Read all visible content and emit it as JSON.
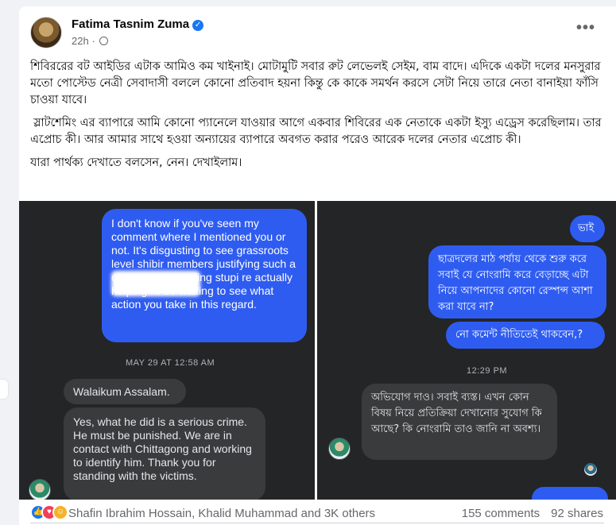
{
  "post": {
    "author": "Fatima Tasnim Zuma",
    "time": "22h",
    "more_label": "•••",
    "verified_icon": "verified-badge-icon",
    "paragraphs": [
      "শিবিররের বট আইডির এটাক আমিও কম খাইনাই। মোটামুটি সবার রুট লেভেলই সেইম, বাম বাদে। এদিকে একটা দলের মনসুরার মতো পোস্টেড নেত্রী সেবাদাসী বললে কোনো প্রতিবাদ হয়না কিন্তু কে কাকে সমর্থন করসে সেটা নিয়ে তারে নেতা বানাইয়া ফাঁসি চাওয়া যাবে।",
      "স্লাটশেমিং এর ব্যাপারে আমি কোনো প্যানেলে যাওয়ার আগে একবার শিবিরের এক নেতাকে একটা ইস্যু এড্রেস করেছিলাম। তার এপ্রোচ কী। আর আমার সাথে হওয়া অন্যায়ের ব্যাপারে অবগত করার পরেও আরেক দলের নেতার এপ্রোচ কী।",
      "যারা পার্থক্য দেখাতে বলসেন, নেন। দেখাইলাম।"
    ]
  },
  "left_chat": {
    "sent_message": "I don't know if you've seen my comment where I mentioned you or not. It's disgusting to see grassroots level shibir members justifying such a crime and spreading stupi                  re actually helping                    I'll be waiting to see what action you take in this regard.",
    "timestamp": "MAY 29 AT 12:58 AM",
    "reply_1": "Walaikum Assalam.",
    "reply_2": "Yes, what he did is a serious crime. He must be punished. We are in contact with Chittagong and working to identify him. Thank you for standing with the victims."
  },
  "right_chat": {
    "msg_1": "ভাই",
    "msg_2": "ছাত্রদলের মাঠ পর্যায় থেকে শুরু করে সবাই যে নোংরামি করে বেড়াচ্ছে এটা নিয়ে আপনাদের কোনো রেস্পন্স আশা করা যাবে না?",
    "msg_3": "নো কমেন্ট নীতিতেই থাকবেন,?",
    "timestamp": "12:29 PM",
    "reply": "অভিযোগ দাও। সবাই ব্যস্ত। এখন কোন বিষয় নিয়ে প্রতিক্রিয়া দেখানোর সুযোগ কি আছে? কি নোংরামি তাও জানি না অবশ্য।"
  },
  "footer": {
    "reactors": "Shafin Ibrahim Hossain, Khalid Muhammad and 3K others",
    "comments": "155 comments",
    "shares": "92 shares",
    "reaction_icons": [
      "like-icon",
      "love-icon",
      "care-icon"
    ]
  },
  "colors": {
    "sent_bubble": "#2f5cf0",
    "received_bubble": "#3a3b3c",
    "chat_background": "#242526",
    "link_blue": "#1877f2"
  }
}
